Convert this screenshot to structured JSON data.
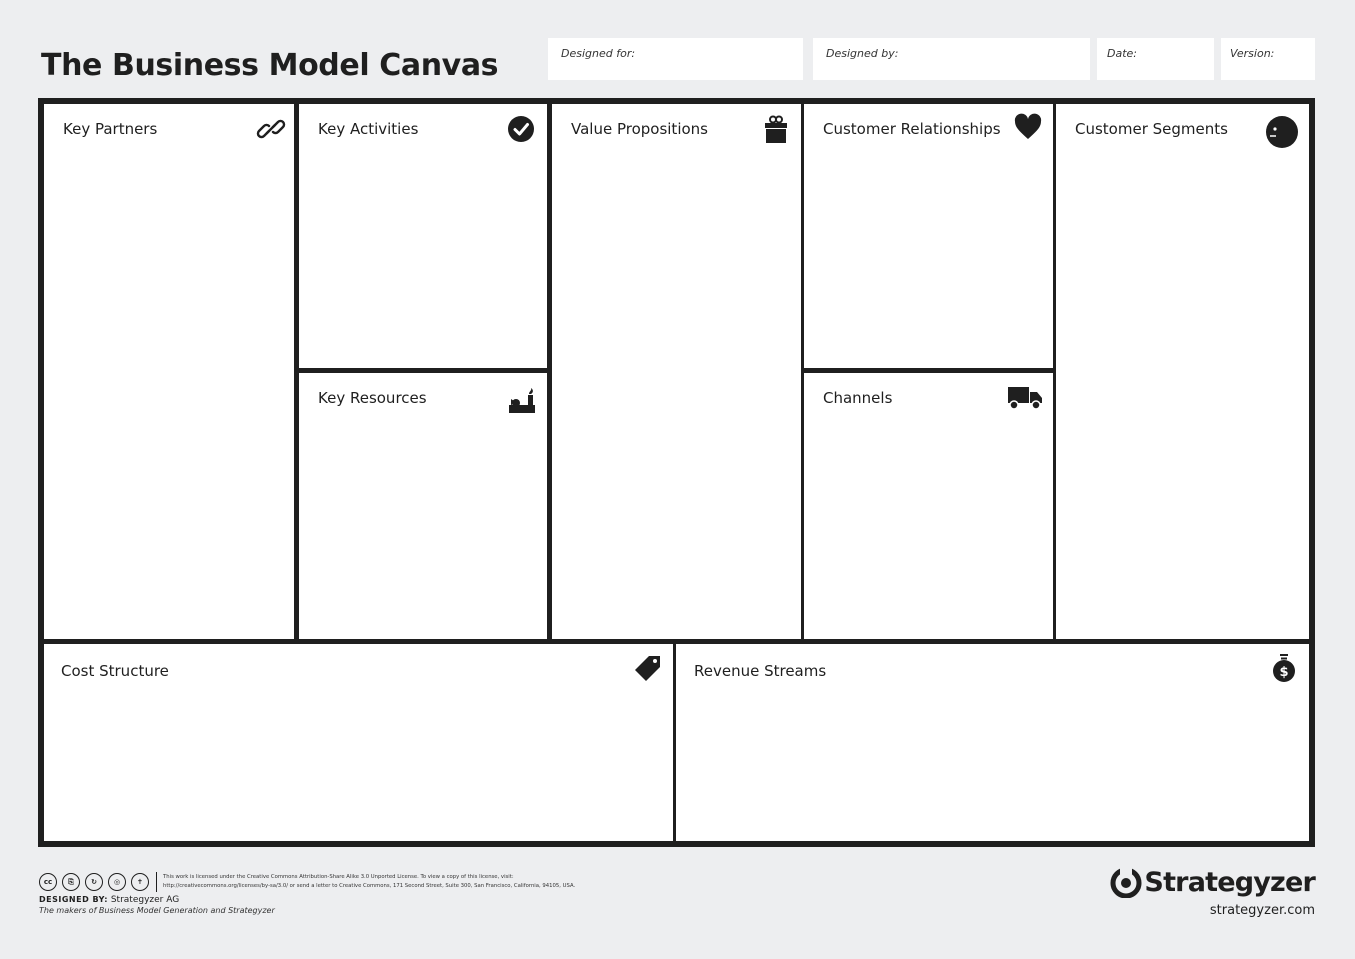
{
  "header": {
    "title": "The Business Model Canvas",
    "designed_for": "Designed for:",
    "designed_by": "Designed by:",
    "date": "Date:",
    "version": "Version:"
  },
  "blocks": {
    "key_partners": {
      "label": "Key Partners",
      "icon": "link-icon"
    },
    "key_activities": {
      "label": "Key Activities",
      "icon": "check-circle-icon"
    },
    "key_resources": {
      "label": "Key Resources",
      "icon": "factory-icon"
    },
    "value_propositions": {
      "label": "Value Propositions",
      "icon": "gift-icon"
    },
    "customer_relationships": {
      "label": "Customer Relationships",
      "icon": "heart-icon"
    },
    "channels": {
      "label": "Channels",
      "icon": "truck-icon"
    },
    "customer_segments": {
      "label": "Customer Segments",
      "icon": "face-icon"
    },
    "cost_structure": {
      "label": "Cost Structure",
      "icon": "price-tag-icon"
    },
    "revenue_streams": {
      "label": "Revenue Streams",
      "icon": "money-bag-icon"
    }
  },
  "footer": {
    "license_line1": "This work is licensed under the Creative Commons Attribution-Share Alike 3.0 Unported License. To view a copy of this license, visit:",
    "license_line2": "http://creativecommons.org/licenses/by-sa/3.0/ or send a letter to Creative Commons, 171 Second Street, Suite 300, San Francisco, California, 94105, USA.",
    "designed_by_label": "DESIGNED BY:",
    "designed_by_value": "Strategyzer AG",
    "makers": "The makers of Business Model Generation and Strategyzer",
    "brand": "Strategyzer",
    "url": "strategyzer.com"
  },
  "colors": {
    "background": "#edeef0",
    "ink": "#1f1f1f",
    "panel": "#ffffff"
  }
}
